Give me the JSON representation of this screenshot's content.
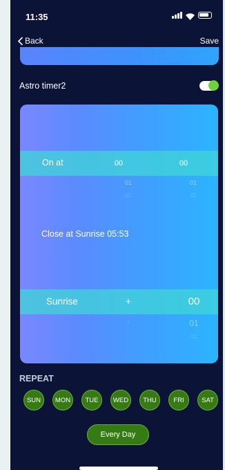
{
  "status_bar": {
    "time": "11:35"
  },
  "nav": {
    "back_label": "Back",
    "save_label": "Save"
  },
  "timer": {
    "name": "Astro timer2",
    "enabled": true
  },
  "card": {
    "on_at": {
      "label": "On at",
      "hours": {
        "selected": "00",
        "next": "01",
        "next2": "02"
      },
      "minutes": {
        "selected": "00",
        "next": "01",
        "next2": "02"
      }
    },
    "close_text": "Close at Sunrise  05:53",
    "sunrise": {
      "label": "Sunrise",
      "sign": {
        "selected": "+",
        "next": "-"
      },
      "minutes": {
        "selected": "00",
        "next": "01",
        "next2": "02"
      }
    }
  },
  "repeat": {
    "label": "REPEAT",
    "days": [
      "SUN",
      "MON",
      "TUE",
      "WED",
      "THU",
      "FRI",
      "SAT"
    ],
    "every_day_label": "Every Day"
  },
  "colors": {
    "background": "#0b1436",
    "day_button": "#367a14",
    "toggle_on": "#6fd03a",
    "band": "#40d6d7"
  }
}
